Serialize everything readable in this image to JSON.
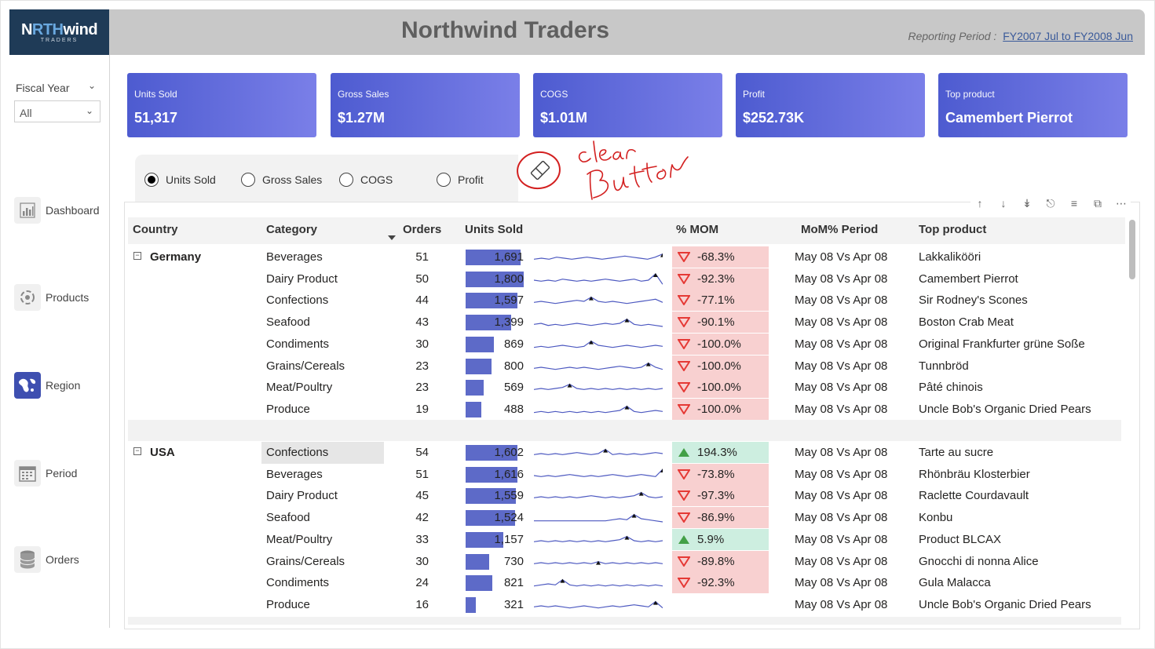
{
  "app": {
    "logo_main_a": "N",
    "logo_main_b": "RTH",
    "logo_main_c": "wind",
    "logo_sub": "TRADERS",
    "title": "Northwind Traders",
    "period_label": "Reporting Period : ",
    "period_value": "FY2007 Jul to FY2008 Jun"
  },
  "filter": {
    "label": "Fiscal Year",
    "selected": "All"
  },
  "nav": [
    {
      "label": "Dashboard",
      "icon": "bar-chart-icon"
    },
    {
      "label": "Products",
      "icon": "products-icon"
    },
    {
      "label": "Region",
      "icon": "globe-map-icon"
    },
    {
      "label": "Period",
      "icon": "calendar-icon"
    },
    {
      "label": "Orders",
      "icon": "database-icon"
    }
  ],
  "kpis": [
    {
      "label": "Units Sold",
      "value": "51,317"
    },
    {
      "label": "Gross Sales",
      "value": "$1.27M"
    },
    {
      "label": "COGS",
      "value": "$1.01M"
    },
    {
      "label": "Profit",
      "value": "$252.73K"
    },
    {
      "label": "Top product",
      "value": "Camembert Pierrot"
    }
  ],
  "measure_options": [
    {
      "label": "Units Sold",
      "selected": true
    },
    {
      "label": "Gross Sales",
      "selected": false
    },
    {
      "label": "COGS",
      "selected": false
    },
    {
      "label": "Profit",
      "selected": false
    }
  ],
  "annotation": {
    "line1": "clear",
    "line2": "Button"
  },
  "colors": {
    "kpi_start": "#4d5bd0",
    "kpi_end": "#7a7fe8",
    "bar": "#5d6ac8",
    "neg_bg": "#f8d0d0",
    "pos_bg": "#cdeee0",
    "neg_icon": "#e53935",
    "pos_icon": "#43a047",
    "annotation": "#d32020"
  },
  "table": {
    "headers": {
      "country": "Country",
      "category": "Category",
      "orders": "Orders",
      "units": "Units Sold",
      "mom": "% MOM",
      "mom_period": "MoM% Period",
      "top_product": "Top product"
    },
    "bar_max": 1800,
    "groups": [
      {
        "country": "Germany",
        "rows": [
          {
            "category": "Beverages",
            "orders": "51",
            "units": "1,691",
            "units_num": 1691,
            "mom": "-68.3%",
            "dir": "neg",
            "period": "May 08 Vs Apr 08",
            "top": "Lakkalikööri",
            "spark": [
              5,
              6,
              5,
              7,
              6,
              5,
              6,
              7,
              6,
              5,
              6,
              7,
              8,
              7,
              6,
              5,
              7,
              10
            ]
          },
          {
            "category": "Dairy Product",
            "orders": "50",
            "units": "1,800",
            "units_num": 1800,
            "mom": "-92.3%",
            "dir": "neg",
            "period": "May 08 Vs Apr 08",
            "top": "Camembert Pierrot",
            "spark": [
              6,
              5,
              6,
              5,
              7,
              6,
              5,
              6,
              5,
              6,
              7,
              6,
              5,
              6,
              7,
              5,
              6,
              12,
              2
            ]
          },
          {
            "category": "Confections",
            "orders": "44",
            "units": "1,597",
            "units_num": 1597,
            "mom": "-77.1%",
            "dir": "neg",
            "period": "May 08 Vs Apr 08",
            "top": "Sir Rodney's Scones",
            "spark": [
              5,
              6,
              5,
              4,
              5,
              6,
              7,
              6,
              10,
              6,
              5,
              6,
              5,
              4,
              5,
              6,
              7,
              8,
              5
            ]
          },
          {
            "category": "Seafood",
            "orders": "43",
            "units": "1,399",
            "units_num": 1399,
            "mom": "-90.1%",
            "dir": "neg",
            "period": "May 08 Vs Apr 08",
            "top": "Boston Crab Meat",
            "spark": [
              5,
              6,
              4,
              5,
              4,
              5,
              6,
              5,
              4,
              5,
              6,
              5,
              6,
              10,
              5,
              4,
              5,
              4,
              3
            ]
          },
          {
            "category": "Condiments",
            "orders": "30",
            "units": "869",
            "units_num": 869,
            "mom": "-100.0%",
            "dir": "neg",
            "period": "May 08 Vs Apr 08",
            "top": "Original Frankfurter grüne Soße",
            "spark": [
              4,
              5,
              4,
              5,
              6,
              5,
              4,
              5,
              10,
              6,
              5,
              4,
              5,
              6,
              5,
              4,
              5,
              6,
              5
            ]
          },
          {
            "category": "Grains/Cereals",
            "orders": "23",
            "units": "800",
            "units_num": 800,
            "mom": "-100.0%",
            "dir": "neg",
            "period": "May 08 Vs Apr 08",
            "top": "Tunnbröd",
            "spark": [
              5,
              6,
              5,
              4,
              5,
              6,
              5,
              6,
              5,
              4,
              5,
              6,
              7,
              6,
              5,
              6,
              10,
              6,
              4
            ]
          },
          {
            "category": "Meat/Poultry",
            "orders": "23",
            "units": "569",
            "units_num": 569,
            "mom": "-100.0%",
            "dir": "neg",
            "period": "May 08 Vs Apr 08",
            "top": "Pâté chinois",
            "spark": [
              5,
              6,
              5,
              6,
              7,
              10,
              6,
              5,
              6,
              5,
              6,
              5,
              6,
              5,
              6,
              5,
              6,
              5,
              6
            ]
          },
          {
            "category": "Produce",
            "orders": "19",
            "units": "488",
            "units_num": 488,
            "mom": "-100.0%",
            "dir": "neg",
            "period": "May 08 Vs Apr 08",
            "top": "Uncle Bob's Organic Dried Pears",
            "spark": [
              4,
              5,
              4,
              5,
              4,
              5,
              4,
              5,
              4,
              5,
              4,
              5,
              6,
              10,
              5,
              4,
              5,
              6,
              5
            ]
          }
        ]
      },
      {
        "country": "USA",
        "rows": [
          {
            "category": "Confections",
            "orders": "54",
            "units": "1,602",
            "units_num": 1602,
            "mom": "194.3%",
            "dir": "pos",
            "period": "May 08 Vs Apr 08",
            "top": "Tarte au sucre",
            "spark": [
              5,
              6,
              5,
              6,
              5,
              6,
              7,
              6,
              5,
              6,
              10,
              5,
              6,
              5,
              6,
              5,
              6,
              7,
              6
            ],
            "highlight": true
          },
          {
            "category": "Beverages",
            "orders": "51",
            "units": "1,616",
            "units_num": 1616,
            "mom": "-73.8%",
            "dir": "neg",
            "period": "May 08 Vs Apr 08",
            "top": "Rhönbräu Klosterbier",
            "spark": [
              6,
              5,
              6,
              5,
              6,
              7,
              6,
              5,
              6,
              5,
              6,
              7,
              6,
              5,
              6,
              7,
              6,
              5,
              12
            ]
          },
          {
            "category": "Dairy Product",
            "orders": "45",
            "units": "1,559",
            "units_num": 1559,
            "mom": "-97.3%",
            "dir": "neg",
            "period": "May 08 Vs Apr 08",
            "top": "Raclette Courdavault",
            "spark": [
              5,
              6,
              5,
              6,
              5,
              6,
              5,
              6,
              7,
              6,
              5,
              6,
              5,
              6,
              7,
              10,
              6,
              5,
              6
            ]
          },
          {
            "category": "Seafood",
            "orders": "42",
            "units": "1,524",
            "units_num": 1524,
            "mom": "-86.9%",
            "dir": "neg",
            "period": "May 08 Vs Apr 08",
            "top": "Konbu",
            "spark": [
              4,
              4,
              4,
              4,
              4,
              4,
              4,
              4,
              4,
              4,
              4,
              5,
              6,
              5,
              10,
              6,
              5,
              4,
              3
            ]
          },
          {
            "category": "Meat/Poultry",
            "orders": "33",
            "units": "1,157",
            "units_num": 1157,
            "mom": "5.9%",
            "dir": "pos",
            "period": "May 08 Vs Apr 08",
            "top": "Product BLCAX",
            "spark": [
              5,
              6,
              5,
              6,
              5,
              6,
              5,
              6,
              5,
              6,
              5,
              6,
              7,
              10,
              6,
              5,
              6,
              5,
              6
            ]
          },
          {
            "category": "Grains/Cereals",
            "orders": "30",
            "units": "730",
            "units_num": 730,
            "mom": "-89.8%",
            "dir": "neg",
            "period": "May 08 Vs Apr 08",
            "top": "Gnocchi di nonna Alice",
            "spark": [
              5,
              6,
              5,
              6,
              5,
              6,
              5,
              6,
              5,
              7,
              5,
              6,
              5,
              6,
              5,
              6,
              5,
              6,
              5
            ]
          },
          {
            "category": "Condiments",
            "orders": "24",
            "units": "821",
            "units_num": 821,
            "mom": "-92.3%",
            "dir": "neg",
            "period": "May 08 Vs Apr 08",
            "top": "Gula Malacca",
            "spark": [
              4,
              5,
              6,
              5,
              10,
              5,
              4,
              5,
              4,
              5,
              4,
              5,
              4,
              5,
              4,
              5,
              4,
              5,
              4
            ]
          },
          {
            "category": "Produce",
            "orders": "16",
            "units": "321",
            "units_num": 321,
            "mom": "",
            "dir": "none",
            "period": "May 08 Vs Apr 08",
            "top": "Uncle Bob's Organic Dried Pears",
            "spark": [
              5,
              6,
              5,
              6,
              5,
              4,
              5,
              6,
              5,
              4,
              5,
              6,
              5,
              6,
              7,
              6,
              5,
              10,
              4
            ]
          }
        ]
      }
    ]
  }
}
